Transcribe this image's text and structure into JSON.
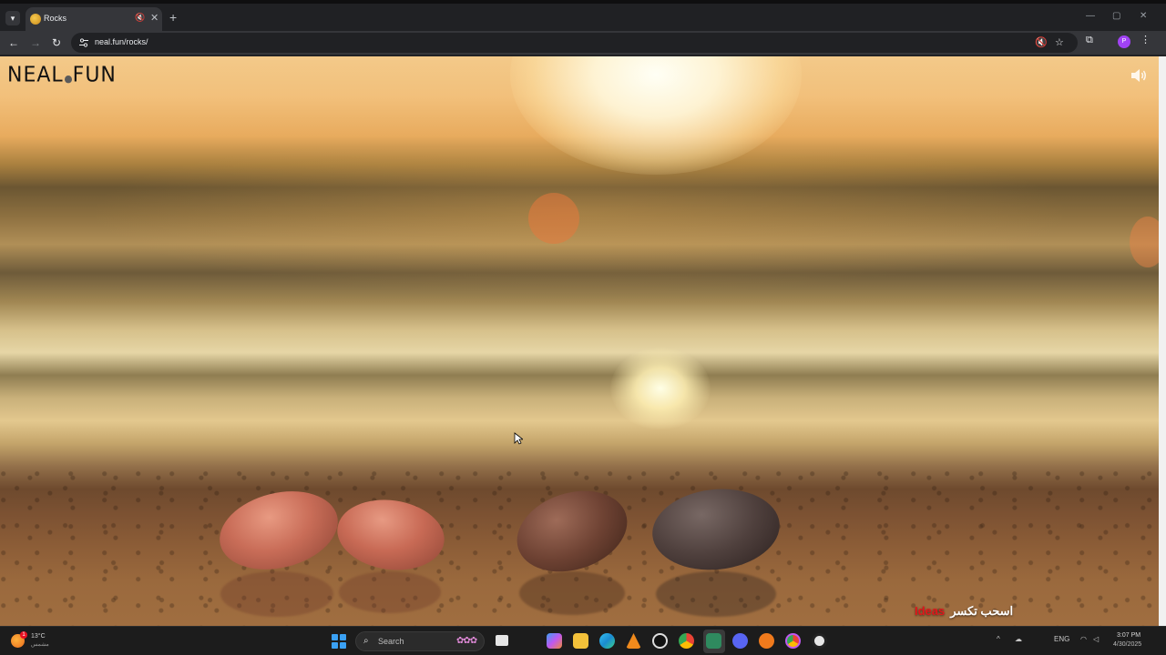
{
  "browser": {
    "tab": {
      "title": "Rocks",
      "close_glyph": "✕",
      "mute_glyph": "🔇"
    },
    "new_tab_glyph": "+",
    "window_controls": {
      "minimize": "—",
      "maximize": "▢",
      "close": "✕"
    },
    "nav": {
      "back": "←",
      "forward": "→",
      "reload": "↻"
    },
    "url": "neal.fun/rocks/",
    "omnibox_icons": [
      "muted-speaker-icon",
      "star-icon"
    ],
    "extensions_icon": "puzzle-icon",
    "profile_initial": "P",
    "menu_glyph": "⋮"
  },
  "page": {
    "logo": {
      "left": "NEAL",
      "right": "FUN"
    },
    "sound_icon": "speaker-icon",
    "rocks": [
      "pink-rock",
      "pink-rock",
      "brown-rock",
      "dark-rock"
    ],
    "drag_hint": {
      "accent": "Ideas",
      "text": "اسحب تكسر"
    }
  },
  "taskbar": {
    "weather": {
      "temp": "13°C",
      "desc": "مشمس",
      "badge": "1"
    },
    "search_placeholder": "Search",
    "apps": [
      "task-view",
      "copilot",
      "file-explorer",
      "edge",
      "vlc",
      "obs",
      "chrome",
      "terminal-app",
      "discord",
      "app-orange",
      "chrome-canary",
      "app-circle"
    ],
    "tray": {
      "lang": "ENG",
      "chevron": "^"
    },
    "clock": {
      "time": "3:07 PM",
      "date": "4/30/2025"
    }
  },
  "colors": {
    "chrome_dark": "#202124",
    "chrome_mid": "#35363a",
    "taskbar": "#1c1c1c",
    "drag_accent": "#e0161b",
    "start_blue": "#3aa0f3"
  }
}
